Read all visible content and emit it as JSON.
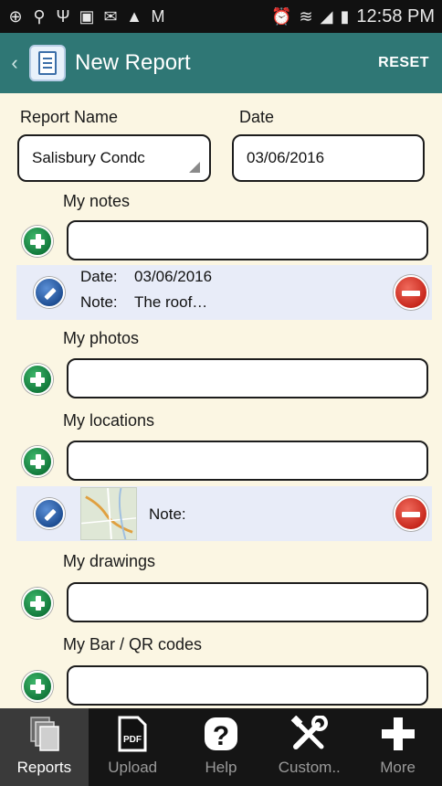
{
  "status_bar": {
    "time": "12:58 PM",
    "left_icons": [
      "add-icon",
      "location-pin-icon",
      "usb-icon",
      "image-icon",
      "message-icon",
      "warning-icon",
      "gmail-icon"
    ],
    "right_icons": [
      "alarm-icon",
      "wifi-icon",
      "signal-icon",
      "battery-icon"
    ]
  },
  "header": {
    "title": "New Report",
    "reset_label": "RESET",
    "bg_color": "#2f7775"
  },
  "form": {
    "report_name_label": "Report Name",
    "report_name_value": "Salisbury Condc",
    "date_label": "Date",
    "date_value": "03/06/2016"
  },
  "sections": {
    "notes": {
      "label": "My notes",
      "input_value": "",
      "entry": {
        "date_label": "Date:",
        "date_value": "03/06/2016",
        "note_label": "Note:",
        "note_value": "The roof…"
      }
    },
    "photos": {
      "label": "My photos",
      "input_value": ""
    },
    "locations": {
      "label": "My locations",
      "input_value": "",
      "entry": {
        "note_label": "Note:"
      }
    },
    "drawings": {
      "label": "My drawings",
      "input_value": ""
    },
    "codes": {
      "label": "My Bar / QR codes",
      "input_value": ""
    }
  },
  "tabbar": {
    "tabs": [
      {
        "label": "Reports",
        "icon": "reports-icon",
        "active": true
      },
      {
        "label": "Upload",
        "icon": "pdf-icon",
        "active": false
      },
      {
        "label": "Help",
        "icon": "help-icon",
        "active": false
      },
      {
        "label": "Custom..",
        "icon": "tools-icon",
        "active": false
      },
      {
        "label": "More",
        "icon": "plus-icon",
        "active": false
      }
    ]
  }
}
